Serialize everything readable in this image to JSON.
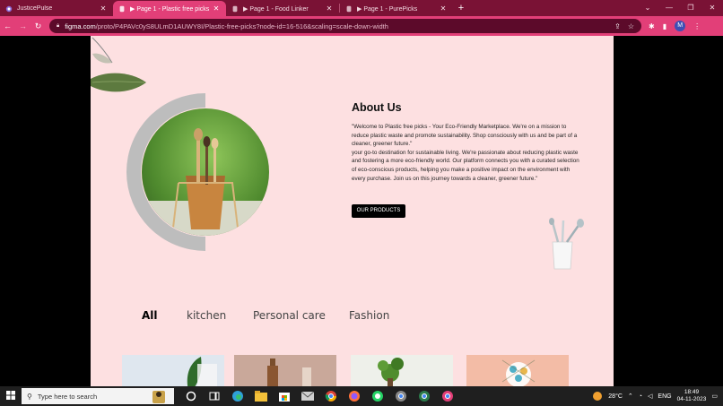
{
  "browser": {
    "tabs": [
      {
        "title": "JusticePulse",
        "active": false
      },
      {
        "title": "▶ Page 1 - Plastic free picks",
        "active": true
      },
      {
        "title": "▶ Page 1 - Food Linker",
        "active": false
      },
      {
        "title": "▶ Page 1 - PurePicks",
        "active": false
      }
    ],
    "new_tab": "+",
    "url_host": "figma.com",
    "url_path": "/proto/P4PAVc0yS8ULmD1AUWY8I/Plastic-free-picks?node-id=16-516&scaling=scale-down-width",
    "profile_initial": "M"
  },
  "page": {
    "about_title": "About Us",
    "about_p1": "\"Welcome to Plastic free picks - Your Eco-Friendly Marketplace. We're on a mission to reduce plastic waste and promote sustainability. Shop consciously with us and be part of a cleaner, greener future.\"",
    "about_p2": "your go-to destination for sustainable living. We're passionate about reducing plastic waste and fostering a more eco-friendly world. Our platform connects you with a curated selection of eco-conscious products, helping you make a positive impact on the environment with every purchase. Join us on this journey towards a cleaner, greener future.\"",
    "cta_label": "OUR PRODUCTS",
    "filters": [
      "All",
      "kitchen",
      "Personal care",
      "Fashion"
    ],
    "active_filter": "All"
  },
  "taskbar": {
    "search_placeholder": "Type here to search",
    "weather": "28°C",
    "language": "ENG",
    "time": "18:49",
    "date": "04-11-2023"
  }
}
